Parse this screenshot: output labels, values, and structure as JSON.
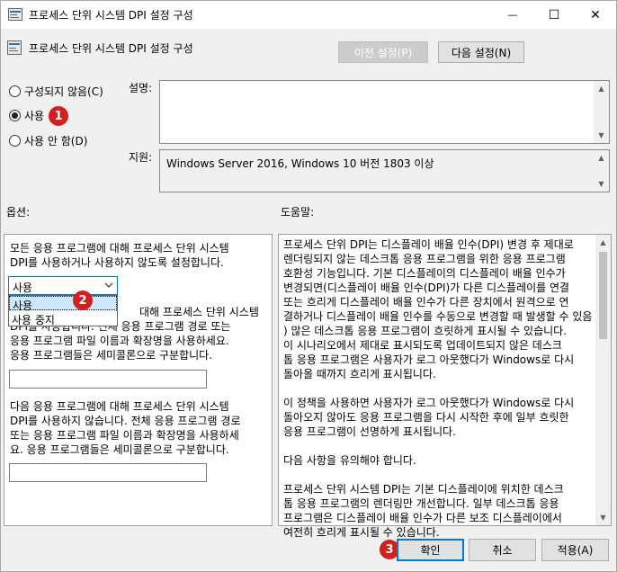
{
  "window": {
    "title": "프로세스 단위 시스템 DPI 설정 구성",
    "minimize_glyph": "—",
    "maximize_glyph": "☐",
    "close_glyph": "✕"
  },
  "header": {
    "title": "프로세스 단위 시스템 DPI 설정 구성",
    "prev_setting": "이전 설정(P)",
    "next_setting": "다음 설정(N)"
  },
  "state": {
    "not_configured": "구성되지 않음(C)",
    "enabled": "사용",
    "disabled": "사용 안 함(D)",
    "selected": "enabled"
  },
  "comment": {
    "label": "설명:",
    "value": ""
  },
  "supported": {
    "label": "지원:",
    "value": "Windows Server 2016, Windows 10 버전 1803 이상"
  },
  "options": {
    "label": "옵션:",
    "text1": [
      "모든 응용 프로그램에 대해 프로세스 단위 시스템",
      "DPI를 사용하거나 사용하지 않도록 설정합니다."
    ],
    "dropdown_value": "사용",
    "dropdown_options": [
      "사용",
      "사용 중지"
    ],
    "text2": [
      "대해 프로세스 단위 시스템",
      "DPI를 사용합니다. 전체 응용 프로그램 경로 또는",
      "응용 프로그램 파일 이름과 확장명을 사용하세요.",
      "응용 프로그램들은 세미콜론으로 구분합니다."
    ],
    "input1": "",
    "text3": [
      "다음 응용 프로그램에 대해 프로세스 단위 시스템",
      "DPI를 사용하지 않습니다. 전체 응용 프로그램 경로",
      "또는 응용 프로그램 파일 이름과 확장명을 사용하세",
      "요. 응용 프로그램들은 세미콜론으로 구분합니다."
    ],
    "input2": ""
  },
  "help": {
    "label": "도움말:",
    "lines": [
      "프로세스 단위 DPI는 디스플레이 배율 인수(DPI) 변경 후 제대로",
      "렌더링되지 않는 데스크톱 응용 프로그램을 위한 응용 프로그램",
      "호환성 기능입니다. 기본 디스플레이의 디스플레이 배율 인수가",
      "변경되면(디스플레이 배율 인수(DPI)가 다른 디스플레이를 연결",
      "또는 흐리게 디스플레이 배율 인수가 다른 장치에서 원격으로 연",
      "결하거나 디스플레이 배율 인수를 수동으로 변경할 때 발생할 수 있음",
      ") 많은 데스크톱 응용 프로그램이 흐릿하게 표시될 수 있습니다.",
      "이 시나리오에서 제대로 표시되도록 업데이트되지 않은 데스크",
      "톱 응용 프로그램은 사용자가 로그 아웃했다가 Windows로 다시",
      "돌아올 때까지 흐리게 표시됩니다.",
      "",
      "이 정책을 사용하면 사용자가 로그 아웃했다가 Windows로 다시",
      "돌아오지 않아도 응용 프로그램을 다시 시작한 후에 일부 흐릿한",
      "응용 프로그램이 선명하게 표시됩니다.",
      "",
      "다음 사항을 유의해야 합니다.",
      "",
      "프로세스 단위 시스템 DPI는 기본 디스플레이에 위치한 데스크",
      "톱 응용 프로그램의 렌더링만 개선합니다. 일부 데스크톱 응용",
      "프로그램은 디스플레이 배율 인수가 다른 보조 디스플레이에서",
      "여전히 흐리게 표시될 수 있습니다."
    ]
  },
  "footer": {
    "ok": "확인",
    "cancel": "취소",
    "apply": "적용(A)"
  },
  "badges": {
    "b1": "1",
    "b2": "2",
    "b3": "3"
  },
  "colors": {
    "badge": "#d2201f",
    "focus": "#0078d7",
    "selection": "#cce8ff"
  }
}
